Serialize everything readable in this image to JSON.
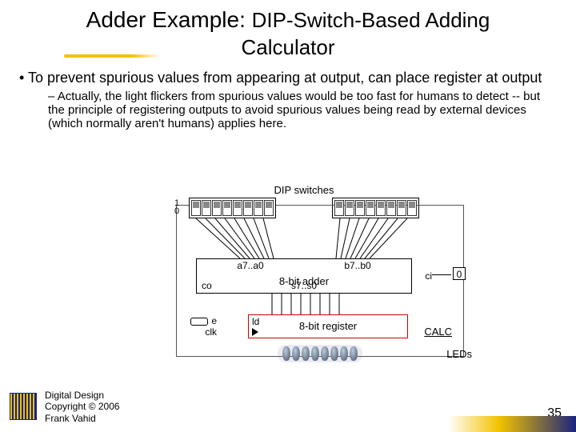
{
  "title_main": "Adder Example: ",
  "title_sub1": "DIP-Switch-Based Adding",
  "title_sub2": "Calculator",
  "bullets": {
    "b1": "To prevent spurious values from appearing at output, can place register at output",
    "s1": "Actually, the light flickers from spurious values would be too fast for humans to detect -- but the principle of registering outputs to avoid spurious values being read by external devices (which normally aren't humans) applies here."
  },
  "diagram": {
    "dip_label": "DIP switches",
    "one": "1",
    "zero": "0",
    "a_port": "a7..a0",
    "b_port": "b7..b0",
    "adder_name": "8-bit adder",
    "co": "co",
    "sout": "s7..s0",
    "ci": "ci",
    "ci_val": "0",
    "reg_name": "8-bit register",
    "ld": "ld",
    "e": "e",
    "clk": "clk",
    "calc": "CALC",
    "leds": "LEDs"
  },
  "footer": {
    "l1": "Digital Design",
    "l2": "Copyright © 2006",
    "l3": "Frank Vahid"
  },
  "page": "35"
}
